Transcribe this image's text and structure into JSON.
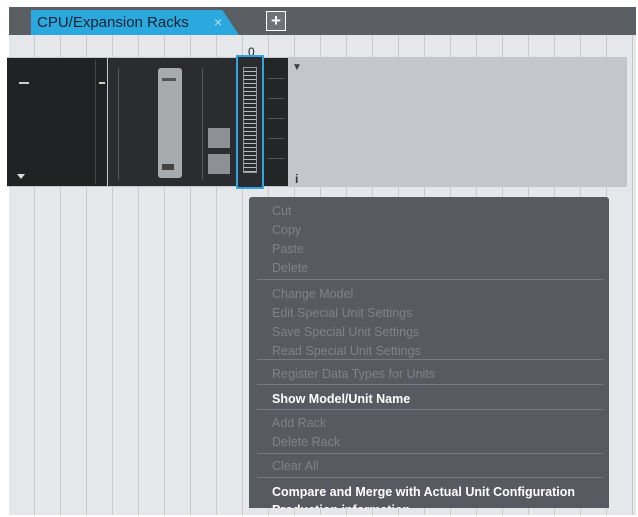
{
  "tab": {
    "label": "CPU/Expansion Racks",
    "close": "×",
    "add": "+"
  },
  "rack": {
    "slot_number": "0",
    "info": "i",
    "arrow": "▼"
  },
  "context_menu": {
    "groups": [
      [
        {
          "label": "Cut",
          "enabled": false
        },
        {
          "label": "Copy",
          "enabled": false
        },
        {
          "label": "Paste",
          "enabled": false
        },
        {
          "label": "Delete",
          "enabled": false
        }
      ],
      [
        {
          "label": "Change Model",
          "enabled": false
        },
        {
          "label": "Edit Special Unit Settings",
          "enabled": false
        },
        {
          "label": "Save Special Unit Settings",
          "enabled": false
        },
        {
          "label": "Read Special Unit Settings",
          "enabled": false
        }
      ],
      [
        {
          "label": "Register Data Types for Units",
          "enabled": false
        }
      ],
      [
        {
          "label": "Show Model/Unit Name",
          "enabled": true
        }
      ],
      [
        {
          "label": "Add Rack",
          "enabled": false
        },
        {
          "label": "Delete Rack",
          "enabled": false
        }
      ],
      [
        {
          "label": "Clear All",
          "enabled": false
        }
      ],
      [
        {
          "label": "Compare and Merge with Actual Unit Configuration",
          "enabled": true
        },
        {
          "label": "Production information",
          "enabled": true
        }
      ]
    ]
  }
}
